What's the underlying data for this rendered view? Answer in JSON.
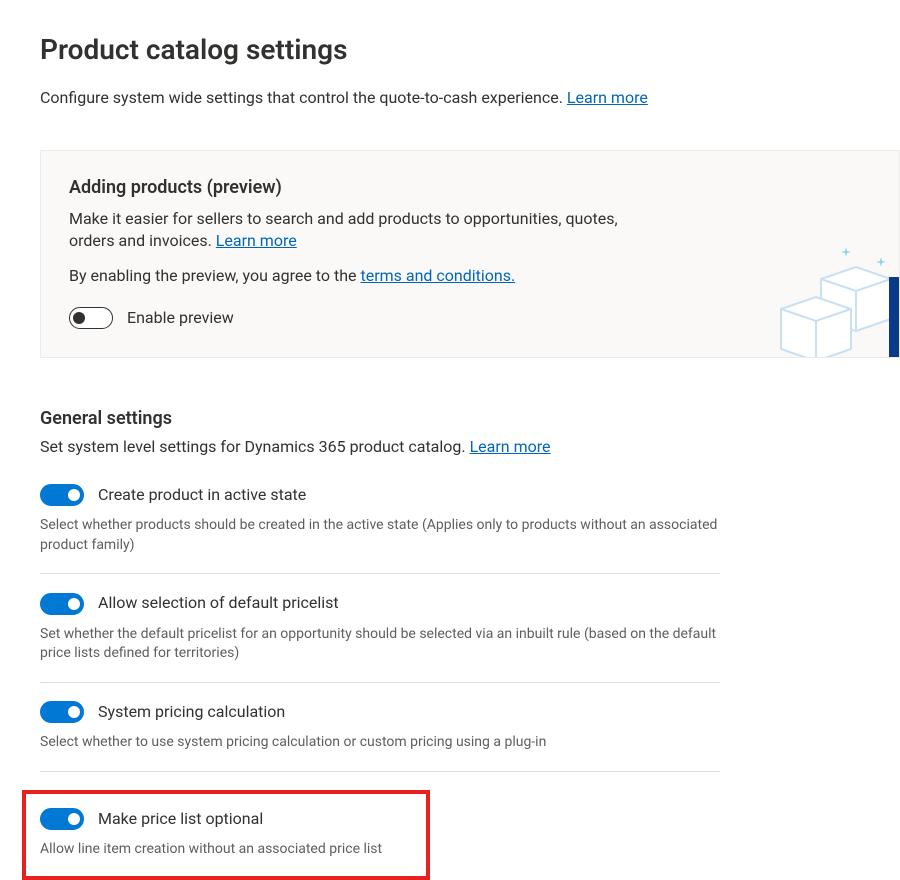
{
  "header": {
    "title": "Product catalog settings",
    "subtitle_prefix": "Configure system wide settings that control the quote-to-cash experience. ",
    "learn_more": "Learn more"
  },
  "preview_card": {
    "title": "Adding products (preview)",
    "desc_prefix": "Make it easier for sellers to search and add products to opportunities, quotes, orders and invoices. ",
    "learn_more": "Learn more",
    "terms_prefix": "By enabling the preview, you agree to the ",
    "terms_link": "terms and conditions.",
    "toggle_label": "Enable preview",
    "toggle_on": false
  },
  "general": {
    "title": "General settings",
    "subtitle_prefix": "Set system level settings for Dynamics 365 product catalog. ",
    "learn_more": "Learn more",
    "settings": [
      {
        "label": "Create product in active state",
        "desc": "Select whether products should be created in the active state (Applies only to products without an associated product family)",
        "on": true
      },
      {
        "label": "Allow selection of default pricelist",
        "desc": "Set whether the default pricelist for an opportunity should be selected via an inbuilt rule (based on the default price lists defined for territories)",
        "on": true
      },
      {
        "label": "System pricing calculation",
        "desc": "Select whether to use system pricing calculation or custom pricing using a plug-in",
        "on": true
      },
      {
        "label": "Make price list optional",
        "desc": "Allow line item creation without an associated price list",
        "on": true
      }
    ]
  }
}
